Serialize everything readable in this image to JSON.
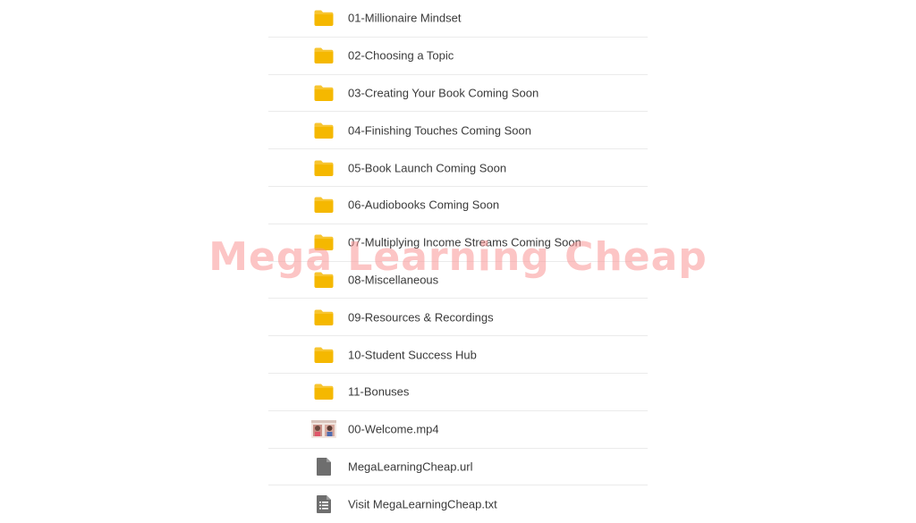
{
  "files": [
    {
      "name": "01-Millionaire Mindset",
      "icon": "folder-icon",
      "type": "folder"
    },
    {
      "name": "02-Choosing a Topic",
      "icon": "folder-icon",
      "type": "folder"
    },
    {
      "name": "03-Creating Your Book Coming Soon",
      "icon": "folder-icon",
      "type": "folder"
    },
    {
      "name": "04-Finishing Touches Coming Soon",
      "icon": "folder-icon",
      "type": "folder"
    },
    {
      "name": "05-Book Launch Coming Soon",
      "icon": "folder-icon",
      "type": "folder"
    },
    {
      "name": "06-Audiobooks Coming Soon",
      "icon": "folder-icon",
      "type": "folder"
    },
    {
      "name": "07-Multiplying Income Streams Coming Soon",
      "icon": "folder-icon",
      "type": "folder"
    },
    {
      "name": "08-Miscellaneous",
      "icon": "folder-icon",
      "type": "folder"
    },
    {
      "name": "09-Resources & Recordings",
      "icon": "folder-icon",
      "type": "folder"
    },
    {
      "name": "10-Student Success Hub",
      "icon": "folder-icon",
      "type": "folder"
    },
    {
      "name": "11-Bonuses",
      "icon": "folder-icon",
      "type": "folder"
    },
    {
      "name": "00-Welcome.mp4",
      "icon": "video-thumbnail-icon",
      "type": "video"
    },
    {
      "name": "MegaLearningCheap.url",
      "icon": "url-file-icon",
      "type": "url"
    },
    {
      "name": "Visit MegaLearningCheap.txt",
      "icon": "text-file-icon",
      "type": "text"
    }
  ],
  "watermark": "Mega Learning Cheap",
  "colors": {
    "folder": "#f5b800",
    "folder_tab": "#f7c531",
    "file_gray": "#6e6e6e",
    "watermark": "#fa9696"
  }
}
